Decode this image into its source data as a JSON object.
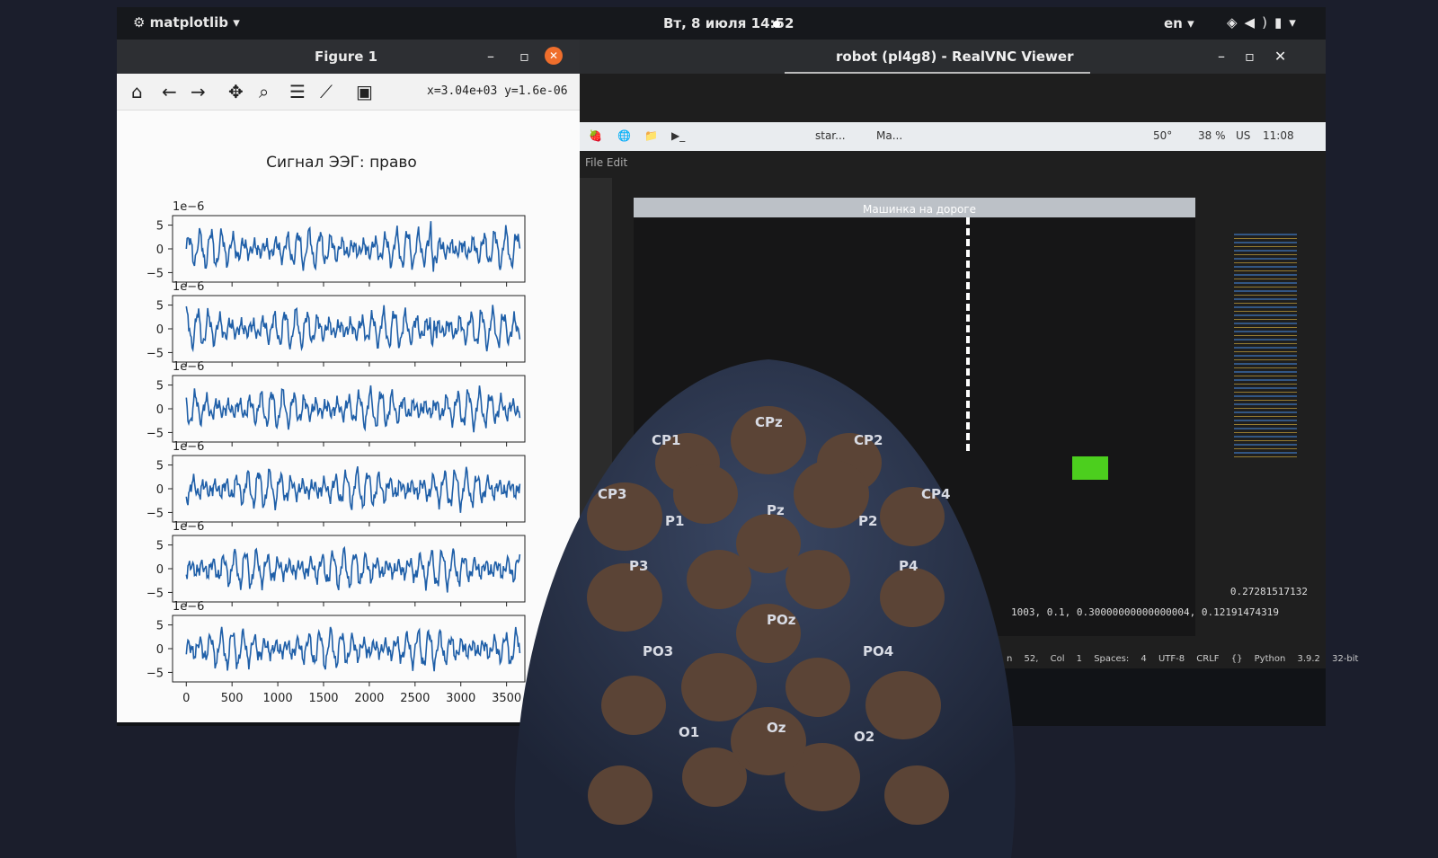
{
  "topbar": {
    "app_name": "matplotlib",
    "clock": "Вт, 8 июля  14:52",
    "lang": "en"
  },
  "figure": {
    "window_title": "Figure 1",
    "coords": "x=3.04e+03 y=1.6e-06",
    "toolbar_icons": [
      "home-icon",
      "back-icon",
      "forward-icon",
      "pan-icon",
      "zoom-icon",
      "configure-icon",
      "edit-axes-icon",
      "save-icon"
    ]
  },
  "chart_data": {
    "type": "line",
    "title": "Сигнал ЭЭГ: право",
    "xlabel": "",
    "ylabel": "",
    "x_ticks": [
      0,
      500,
      1000,
      1500,
      2000,
      2500,
      3000,
      3500
    ],
    "y_ticks": [
      -5,
      0,
      5
    ],
    "scale_label": "1e−6",
    "xlim": [
      -150,
      3700
    ],
    "ylim": [
      -7,
      7
    ],
    "panel_count": 6,
    "grid": false,
    "color": "#1f5fa8"
  },
  "vnc": {
    "window_title": "robot (pl4g8) - RealVNC Viewer",
    "taskbar_items": [
      "star...",
      "Ma..."
    ],
    "cpu_pct": "50°",
    "mem_pct": "38 %",
    "kbd": "US",
    "time": "11:08",
    "menu": [
      "File",
      "Edit"
    ],
    "game_title": "Машинка на дороге",
    "term_line1": "0.27281517132",
    "term_line2": "1003, 0.1, 0.30000000000000004, 0.12191474319",
    "status_bar": "n 52, Col 1   Spaces: 4   UTF-8   CRLF   {} Python   3.9.2 32-bit"
  },
  "cap_labels": [
    "CPz",
    "CP1",
    "CP2",
    "CP3",
    "CP4",
    "P1",
    "Pz",
    "P2",
    "P3",
    "P4",
    "POz",
    "PO3",
    "PO4",
    "Oz",
    "O1",
    "O2"
  ]
}
